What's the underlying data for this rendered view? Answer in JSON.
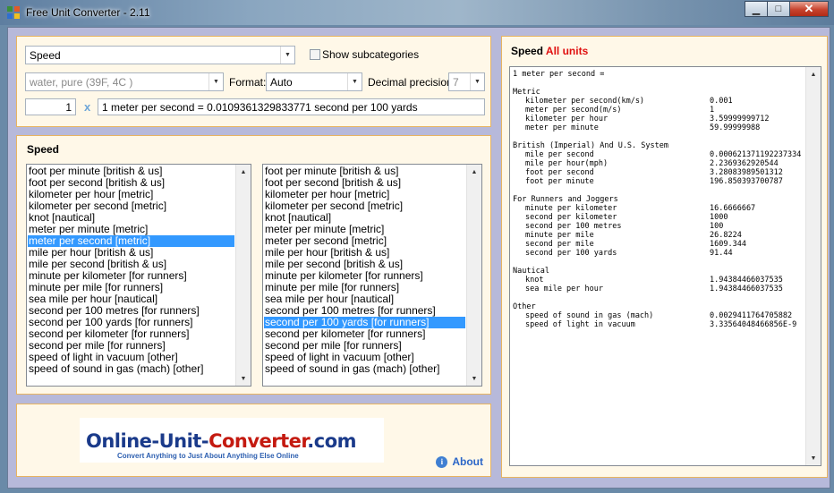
{
  "window": {
    "title": "Free Unit Converter - 2.11"
  },
  "controls": {
    "category": "Speed",
    "show_subcategories": "Show subcategories",
    "substance": "water, pure (39F, 4C )",
    "format_label": "Format:",
    "format_value": "Auto",
    "precision_label": "Decimal precision:",
    "precision_value": "7",
    "amount": "1",
    "times": "x",
    "expression": "1 meter per second = 0.0109361329833771 second per 100 yards"
  },
  "units_panel": {
    "title": "Speed",
    "left_items": [
      "foot per minute [british & us]",
      "foot per second [british & us]",
      "kilometer per hour [metric]",
      "kilometer per second [metric]",
      "knot [nautical]",
      "meter per minute [metric]",
      "meter per second [metric]",
      "mile per hour [british & us]",
      "mile per second [british & us]",
      "minute per kilometer [for runners]",
      "minute per mile [for runners]",
      "sea mile per hour [nautical]",
      "second per 100 metres [for runners]",
      "second per 100 yards [for runners]",
      "second per kilometer [for runners]",
      "second per mile [for runners]",
      "speed of light in vacuum [other]",
      "speed of sound in gas (mach) [other]"
    ],
    "left_selected": 6,
    "right_items": [
      "foot per minute [british & us]",
      "foot per second [british & us]",
      "kilometer per hour [metric]",
      "kilometer per second [metric]",
      "knot [nautical]",
      "meter per minute [metric]",
      "meter per second [metric]",
      "mile per hour [british & us]",
      "mile per second [british & us]",
      "minute per kilometer [for runners]",
      "minute per mile [for runners]",
      "sea mile per hour [nautical]",
      "second per 100 metres [for runners]",
      "second per 100 yards [for runners]",
      "second per kilometer [for runners]",
      "second per mile [for runners]",
      "speed of light in vacuum [other]",
      "speed of sound in gas (mach) [other]"
    ],
    "right_selected": 13
  },
  "branding": {
    "logo_part1": "Online-Unit-",
    "logo_part2": "Converter",
    "logo_part3": ".com",
    "tagline": "Convert Anything to Just About Anything Else Online",
    "about_label": "About"
  },
  "results": {
    "title_prefix": "Speed",
    "title_accent": "All units",
    "header": "1 meter per second =",
    "groups": [
      {
        "name": "Metric",
        "rows": [
          [
            "kilometer per second(km/s)",
            "0.001"
          ],
          [
            "meter per second(m/s)",
            "1"
          ],
          [
            "kilometer per hour",
            "3.59999999712"
          ],
          [
            "meter per minute",
            "59.99999988"
          ]
        ]
      },
      {
        "name": "British (Imperial) And U.S. System",
        "rows": [
          [
            "mile per second",
            "0.000621371192237334"
          ],
          [
            "mile per hour(mph)",
            "2.2369362920544"
          ],
          [
            "foot per second",
            "3.28083989501312"
          ],
          [
            "foot per minute",
            "196.850393700787"
          ]
        ]
      },
      {
        "name": "For Runners and Joggers",
        "rows": [
          [
            "minute per kilometer",
            "16.6666667"
          ],
          [
            "second per kilometer",
            "1000"
          ],
          [
            "second per 100 metres",
            "100"
          ],
          [
            "minute per mile",
            "26.8224"
          ],
          [
            "second per mile",
            "1609.344"
          ],
          [
            "second per 100 yards",
            "91.44"
          ]
        ]
      },
      {
        "name": "Nautical",
        "rows": [
          [
            "knot",
            "1.94384466037535"
          ],
          [
            "sea mile per hour",
            "1.94384466037535"
          ]
        ]
      },
      {
        "name": "Other",
        "rows": [
          [
            "speed of sound in gas (mach)",
            "0.0029411764705882"
          ],
          [
            "speed of light in vacuum",
            "3.33564048466856E-9"
          ]
        ]
      }
    ]
  },
  "icons": {
    "app": "unit-converter-icon",
    "minimize": "minimize-icon",
    "maximize": "maximize-icon",
    "close": "close-icon",
    "info": "info-icon"
  },
  "colors": {
    "panel_bg": "#fff8e8",
    "panel_border": "#e8b460",
    "selection": "#3399ff",
    "accent_red": "#e01010"
  }
}
